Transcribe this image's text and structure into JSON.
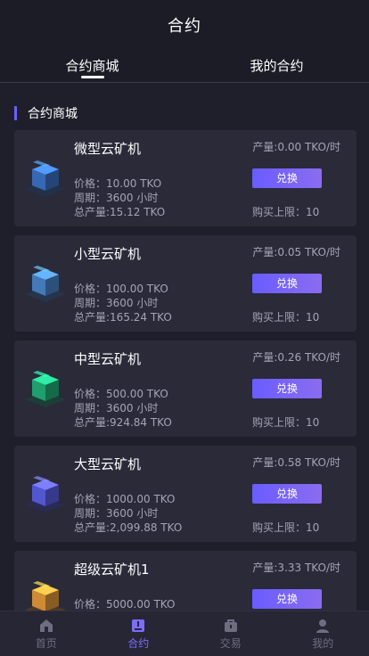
{
  "header": {
    "title": "合约"
  },
  "tabs": [
    {
      "label": "合约商城",
      "active": true
    },
    {
      "label": "我的合约",
      "active": false
    }
  ],
  "section": {
    "title": "合约商城"
  },
  "cards": [
    {
      "name": "微型云矿机",
      "price": "价格：10.00 TKO",
      "period": "周期：3600 小时",
      "total": "总产量:15.12 TKO",
      "rate": "产量:0.00 TKO/时",
      "button": "兑换",
      "limit": "购买上限：10",
      "icon_color": "#3d73c8"
    },
    {
      "name": "小型云矿机",
      "price": "价格：100.00 TKO",
      "period": "周期：3600 小时",
      "total": "总产量:165.24 TKO",
      "rate": "产量:0.05 TKO/时",
      "button": "兑换",
      "limit": "购买上限：10",
      "icon_color": "#4b86cc"
    },
    {
      "name": "中型云矿机",
      "price": "价格：500.00 TKO",
      "period": "周期：3600 小时",
      "total": "总产量:924.84 TKO",
      "rate": "产量:0.26 TKO/时",
      "button": "兑换",
      "limit": "购买上限：10",
      "icon_color": "#22b07a"
    },
    {
      "name": "大型云矿机",
      "price": "价格：1000.00 TKO",
      "period": "周期：3600 小时",
      "total": "总产量:2,099.88 TKO",
      "rate": "产量:0.58 TKO/时",
      "button": "兑换",
      "limit": "购买上限：10",
      "icon_color": "#5b5fe6"
    },
    {
      "name": "超级云矿机1",
      "price": "价格：5000.00 TKO",
      "period": "",
      "total": "",
      "rate": "产量:3.33 TKO/时",
      "button": "兑换",
      "limit": "",
      "icon_color": "#e39a3a"
    }
  ],
  "nav": [
    {
      "label": "首页",
      "icon": "home-icon",
      "active": false
    },
    {
      "label": "合约",
      "icon": "contract-icon",
      "active": true
    },
    {
      "label": "交易",
      "icon": "trade-icon",
      "active": false
    },
    {
      "label": "我的",
      "icon": "user-icon",
      "active": false
    }
  ],
  "colors": {
    "accent": "#6b63ff",
    "card_bg": "#2a2a39",
    "page_bg": "#1f1f2b"
  }
}
